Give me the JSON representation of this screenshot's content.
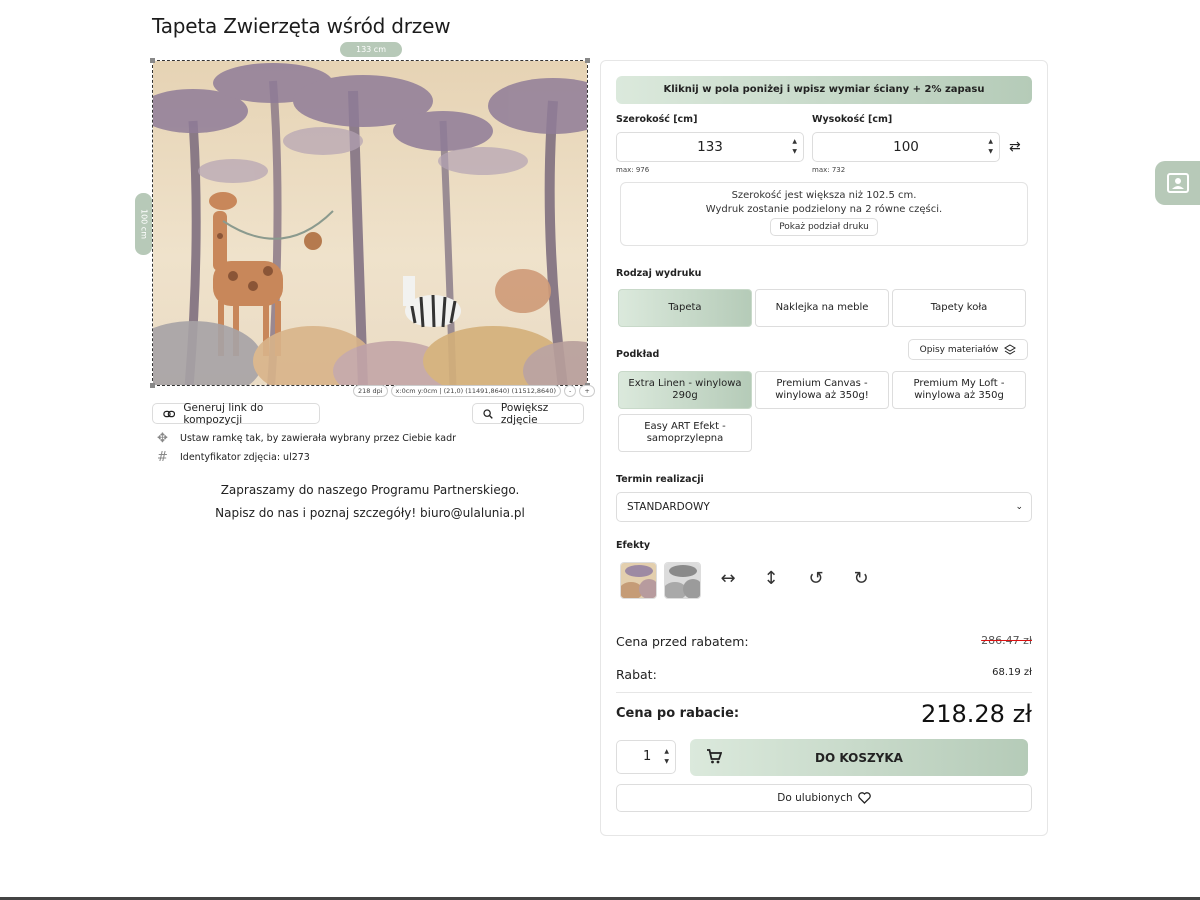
{
  "product": {
    "title": "Tapeta Zwierzęta wśród drzew",
    "width_badge": "133 cm",
    "height_badge": "100 cm",
    "info_strip": [
      "218 dpi",
      "x:0cm y:0cm | (21,0) (11491,8640) (11512,8640)",
      "-",
      "+"
    ],
    "link_button": "Generuj link do kompozycji",
    "zoom_button": "Powiększ zdjęcie",
    "note_frame": "Ustaw ramkę tak, by zawierała wybrany przez Ciebie kadr",
    "note_id": "Identyfikator zdjęcia: ul273",
    "partner_line1": "Zapraszamy do naszego Programu Partnerskiego.",
    "partner_line2": "Napisz do nas i poznaj szczegóły! biuro@ulalunia.pl"
  },
  "config": {
    "hint": "Kliknij w pola poniżej i wpisz wymiar ściany + 2% zapasu",
    "width_label": "Szerokość [cm]",
    "width_value": "133",
    "width_max": "max: 976",
    "height_label": "Wysokość [cm]",
    "height_value": "100",
    "height_max": "max: 732",
    "split_line1": "Szerokość jest większa niż 102.5 cm.",
    "split_line2": "Wydruk zostanie podzielony na 2 równe części.",
    "split_button": "Pokaż podział druku",
    "print_type_label": "Rodzaj wydruku",
    "print_types": [
      "Tapeta",
      "Naklejka na meble",
      "Tapety koła"
    ],
    "substrate_label": "Podkład",
    "materials_button": "Opisy materiałów",
    "substrates": [
      "Extra Linen - winylowa 290g",
      "Premium Canvas - winylowa aż 350g!",
      "Premium My Loft - winylowa aż 350g",
      "Easy ART Efekt - samoprzylepna"
    ],
    "term_label": "Termin realizacji",
    "term_value": "STANDARDOWY",
    "effects_label": "Efekty"
  },
  "pricing": {
    "before_label": "Cena przed rabatem:",
    "before_value": "286.47 zł",
    "discount_label": "Rabat:",
    "discount_value": "68.19 zł",
    "final_label": "Cena po rabacie:",
    "final_value": "218.28 zł",
    "quantity": "1",
    "cart_button": "DO KOSZYKA",
    "favorites_button": "Do ulubionych"
  },
  "colors": {
    "accent": "#b7c9b8",
    "accent_light": "#dbe9dc",
    "strike": "#dd1111"
  },
  "icons": [
    "link-icon",
    "magnifier-icon",
    "move-icon",
    "hash-icon",
    "swap-icon",
    "layers-icon",
    "flip-horizontal-icon",
    "flip-vertical-icon",
    "rotate-left-icon",
    "rotate-right-icon",
    "cart-icon",
    "heart-icon",
    "contact-card-icon",
    "chevron-down-icon"
  ]
}
